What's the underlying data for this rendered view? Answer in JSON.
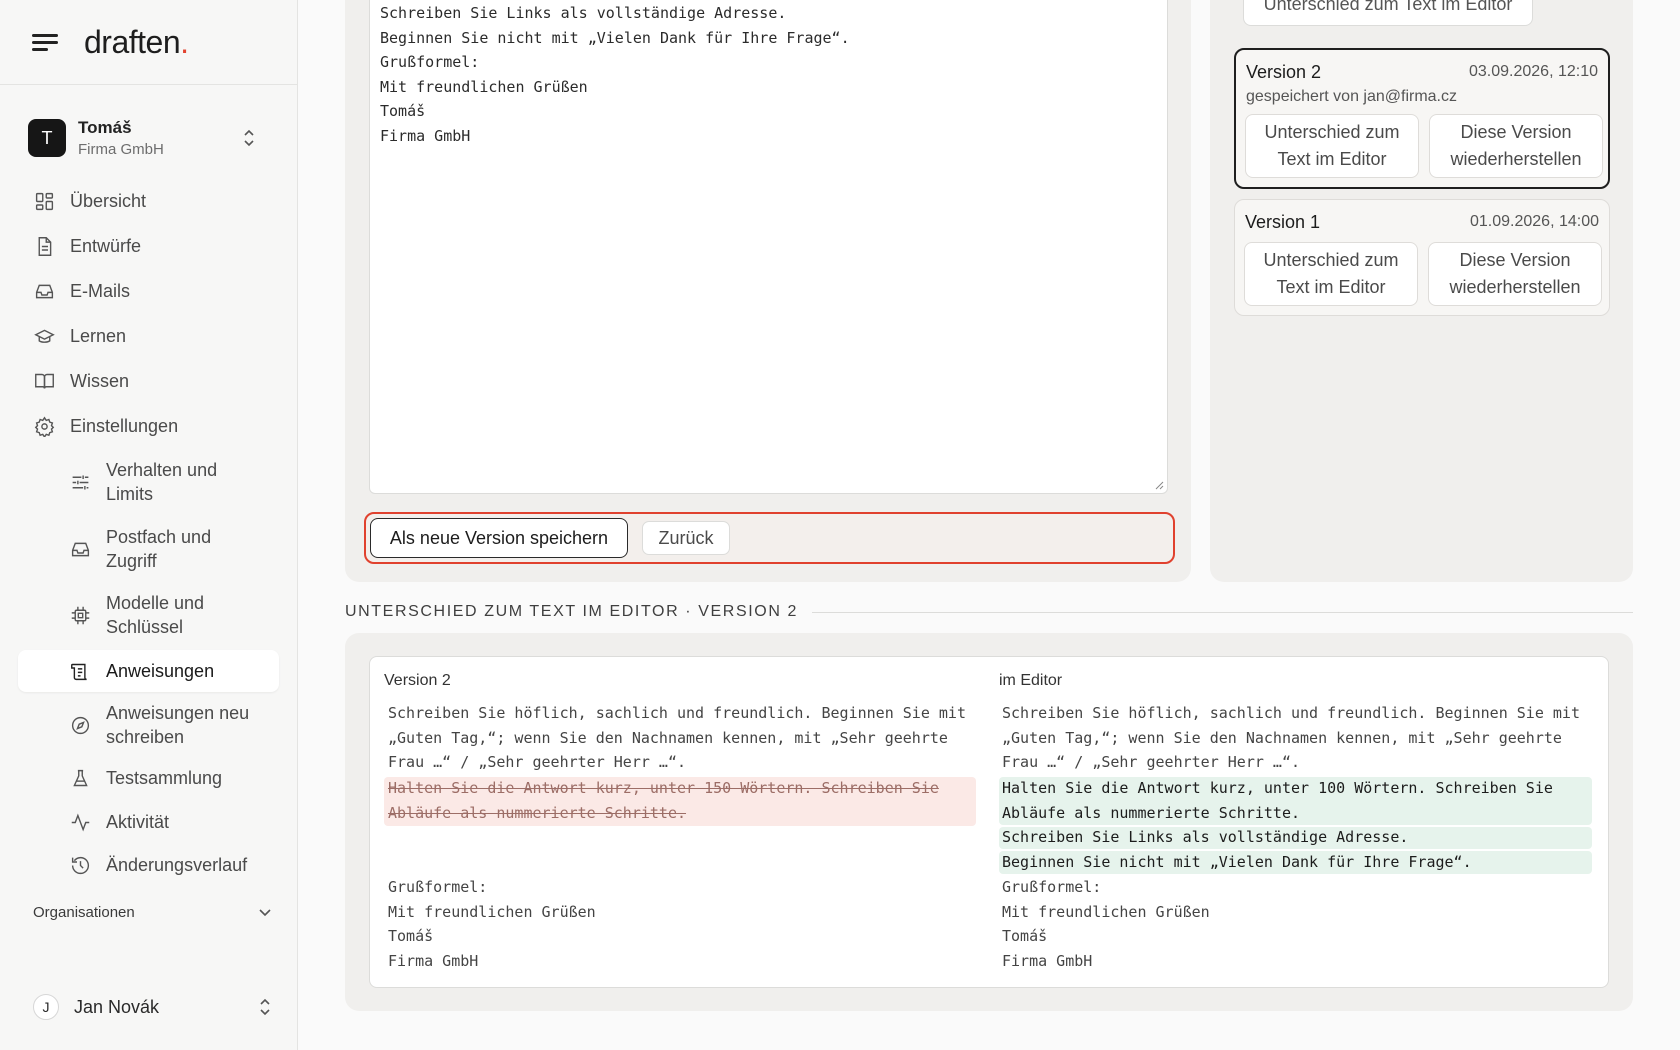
{
  "brand": {
    "name": "draften",
    "dot": "."
  },
  "account": {
    "initial": "T",
    "name": "Tomáš",
    "company": "Firma GmbH"
  },
  "nav": [
    {
      "label": "Übersicht",
      "icon": "grid-icon"
    },
    {
      "label": "Entwürfe",
      "icon": "document-icon"
    },
    {
      "label": "E-Mails",
      "icon": "inbox-icon"
    },
    {
      "label": "Lernen",
      "icon": "graduation-cap-icon"
    },
    {
      "label": "Wissen",
      "icon": "book-icon"
    },
    {
      "label": "Einstellungen",
      "icon": "gear-icon"
    }
  ],
  "subnav": [
    {
      "label": "Verhalten und\nLimits",
      "icon": "sliders-icon"
    },
    {
      "label": "Postfach und\nZugriff",
      "icon": "inbox-icon"
    },
    {
      "label": "Modelle und\nSchlüssel",
      "icon": "chip-icon"
    },
    {
      "label": "Anweisungen",
      "icon": "scroll-icon",
      "active": true
    },
    {
      "label": "Anweisungen neu\nschreiben",
      "icon": "compass-icon"
    },
    {
      "label": "Testsammlung",
      "icon": "flask-icon"
    },
    {
      "label": "Aktivität",
      "icon": "activity-icon"
    },
    {
      "label": "Änderungsverlauf",
      "icon": "history-icon"
    }
  ],
  "organisations_label": "Organisationen",
  "user": {
    "initial": "J",
    "name": "Jan Novák"
  },
  "editor": {
    "text": "Schreiben Sie Links als vollständige Adresse.\nBeginnen Sie nicht mit „Vielen Dank für Ihre Frage“.\nGrußformel:\nMit freundlichen Grüßen\nTomáš\nFirma GmbH",
    "save_label": "Als neue Version speichern",
    "back_label": "Zurück"
  },
  "versions": {
    "top_button": "Unterschied zum Text im Editor",
    "items": [
      {
        "title": "Version 2",
        "date": "03.09.2026, 12:10",
        "saved_by": "gespeichert von jan@firma.cz",
        "diff_label": "Unterschied zum\nText im Editor",
        "restore_label": "Diese Version\nwiederherstellen",
        "selected": true
      },
      {
        "title": "Version 1",
        "date": "01.09.2026, 14:00",
        "saved_by": "",
        "diff_label": "Unterschied zum\nText im Editor",
        "restore_label": "Diese Version\nwiederherstellen",
        "selected": false
      }
    ]
  },
  "diff": {
    "section_title": "UNTERSCHIED ZUM TEXT IM EDITOR · VERSION 2",
    "left_header": "Version 2",
    "right_header": "im Editor",
    "common_top": [
      "Schreiben Sie höflich, sachlich und freundlich. Beginnen Sie mit",
      "„Guten Tag,“; wenn Sie den Nachnamen kennen, mit „Sehr geehrte",
      "Frau …“ / „Sehr geehrter Herr …“."
    ],
    "removed": [
      "Halten Sie die Antwort kurz, unter 150 Wörtern. Schreiben Sie",
      "Abläufe als nummerierte Schritte."
    ],
    "added": [
      "Halten Sie die Antwort kurz, unter 100 Wörtern. Schreiben Sie",
      "Abläufe als nummerierte Schritte.",
      "Schreiben Sie Links als vollständige Adresse.",
      "Beginnen Sie nicht mit „Vielen Dank für Ihre Frage“."
    ],
    "common_bottom": [
      "Grußformel:",
      "Mit freundlichen Grüßen",
      "Tomáš",
      "Firma GmbH"
    ]
  },
  "colors": {
    "accent": "#e0412e",
    "deleted_bg": "#fbe9e6",
    "added_bg": "#e6f3ec"
  }
}
